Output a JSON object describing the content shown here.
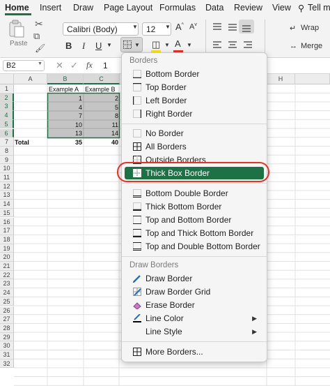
{
  "ribbon": {
    "tabs": [
      "Home",
      "Insert",
      "Draw",
      "Page Layout",
      "Formulas",
      "Data",
      "Review",
      "View",
      "Tell m"
    ],
    "active_tab": "Home"
  },
  "toolbar": {
    "paste_label": "Paste",
    "font_name": "Calibri (Body)",
    "font_size": "12",
    "bold": "B",
    "italic": "I",
    "underline": "U",
    "wrap_label": "Wrap",
    "merge_label": "Merge",
    "accent_color": "#1e7145",
    "font_color_bar": "#e0352b",
    "fill_color_bar": "#f5e52a"
  },
  "formula_bar": {
    "name_box": "B2",
    "fx": "fx",
    "value": "1"
  },
  "grid": {
    "columns": [
      "A",
      "B",
      "C",
      "H"
    ],
    "rows": [
      "1",
      "2",
      "3",
      "4",
      "5",
      "6",
      "7",
      "8",
      "9",
      "10",
      "11",
      "12",
      "13",
      "14",
      "15",
      "16",
      "17",
      "18",
      "19",
      "20",
      "21",
      "22",
      "23",
      "24",
      "25",
      "26",
      "27",
      "28",
      "29",
      "30",
      "31",
      "32"
    ],
    "headers": [
      "Example A",
      "Example B"
    ],
    "data": [
      [
        "1",
        "2"
      ],
      [
        "4",
        "5"
      ],
      [
        "7",
        "8"
      ],
      [
        "10",
        "11"
      ],
      [
        "13",
        "14"
      ]
    ],
    "total_label": "Total",
    "totals": [
      "35",
      "40"
    ]
  },
  "menu": {
    "borders_header": "Borders",
    "group1": [
      "Bottom Border",
      "Top Border",
      "Left Border",
      "Right Border"
    ],
    "group2": [
      "No Border",
      "All Borders",
      "Outside Borders",
      "Thick Box Border"
    ],
    "group3": [
      "Bottom Double Border",
      "Thick Bottom Border",
      "Top and Bottom Border",
      "Top and Thick Bottom Border",
      "Top and Double Bottom Border"
    ],
    "draw_header": "Draw Borders",
    "group4": [
      "Draw Border",
      "Draw Border Grid",
      "Erase Border",
      "Line Color",
      "Line Style"
    ],
    "more": "More Borders...",
    "highlighted": "Thick Box Border",
    "highlight_color": "#1e7145",
    "ring_color": "#e0352b"
  }
}
